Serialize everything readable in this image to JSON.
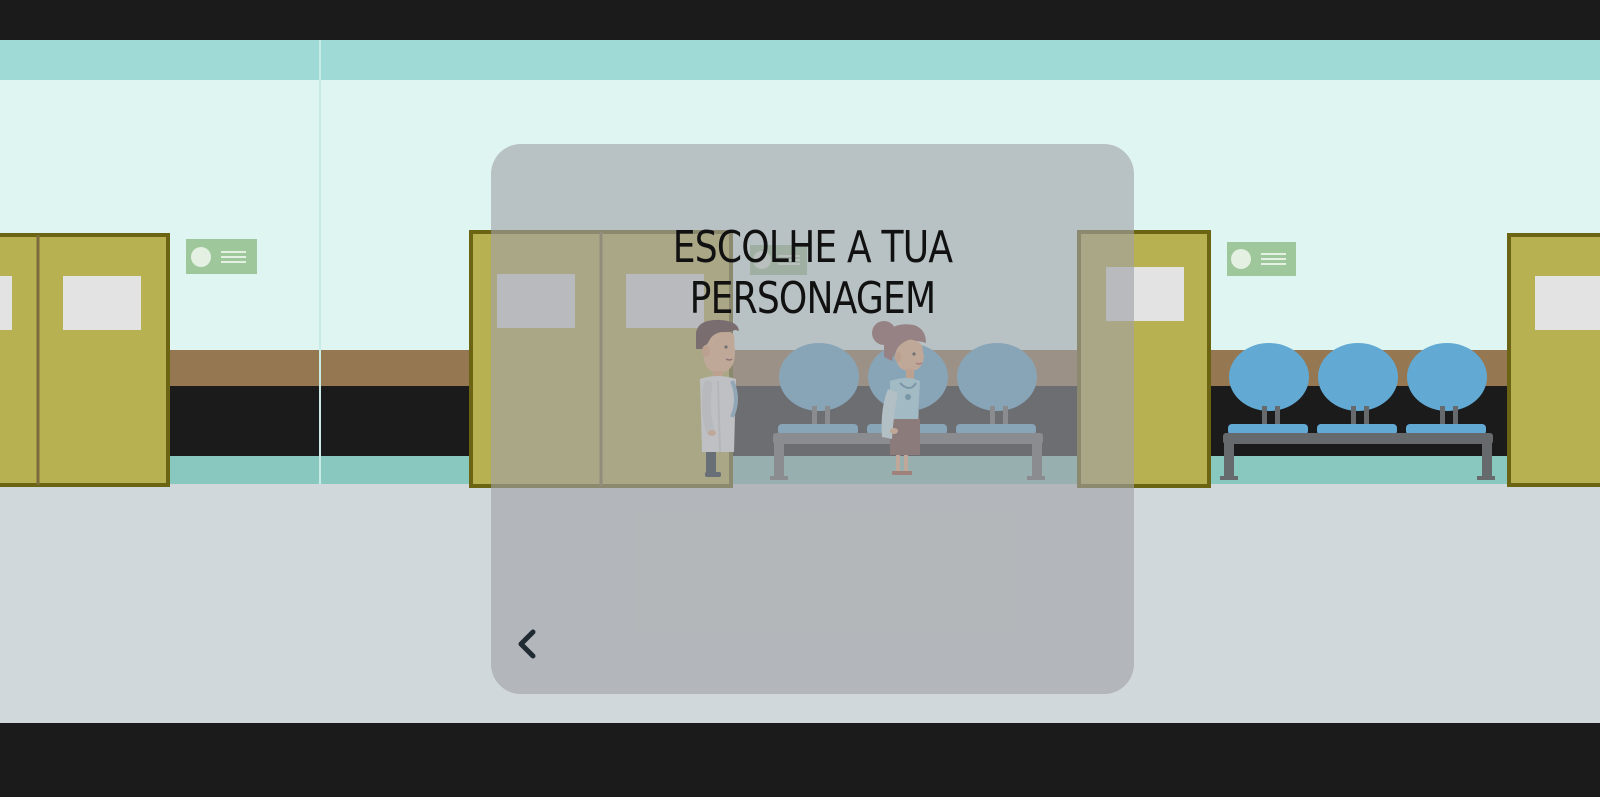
{
  "screen": {
    "title": "ESCOLHE A TUA PERSONAGEM",
    "back_icon": "chevron-left-icon"
  },
  "characters": [
    {
      "id": "doctor",
      "icon": "doctor-character"
    },
    {
      "id": "nurse",
      "icon": "nurse-character"
    }
  ],
  "colors": {
    "letterbox": "#1b1b1b",
    "wall": "#dff5f1",
    "wall_top": "#a0dad6",
    "rail": "#957752",
    "baseboard": "#88c8be",
    "floor": "#d1d8db",
    "door": "#b7b151",
    "door_frame": "#6b6413",
    "chair": "#62aad4",
    "bench": "#666a6d",
    "sign": "#9ec79b",
    "panel_overlay": "rgba(160,162,166,0.62)"
  }
}
